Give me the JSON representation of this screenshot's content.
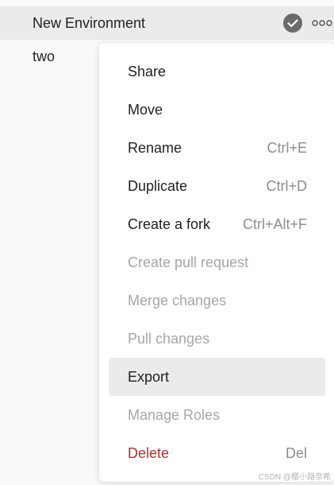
{
  "environments": [
    {
      "name": "New Environment",
      "active": true,
      "status_icon": "check-circle-icon",
      "more_icon": "more-horizontal-icon"
    },
    {
      "name": "two",
      "active": false
    }
  ],
  "context_menu": {
    "items": [
      {
        "label": "Share",
        "shortcut": "",
        "enabled": true
      },
      {
        "label": "Move",
        "shortcut": "",
        "enabled": true
      },
      {
        "label": "Rename",
        "shortcut": "Ctrl+E",
        "enabled": true
      },
      {
        "label": "Duplicate",
        "shortcut": "Ctrl+D",
        "enabled": true
      },
      {
        "label": "Create a fork",
        "shortcut": "Ctrl+Alt+F",
        "enabled": true
      },
      {
        "label": "Create pull request",
        "shortcut": "",
        "enabled": false
      },
      {
        "label": "Merge changes",
        "shortcut": "",
        "enabled": false
      },
      {
        "label": "Pull changes",
        "shortcut": "",
        "enabled": false
      },
      {
        "label": "Export",
        "shortcut": "",
        "enabled": true,
        "hovered": true
      },
      {
        "label": "Manage Roles",
        "shortcut": "",
        "enabled": false
      },
      {
        "label": "Delete",
        "shortcut": "Del",
        "enabled": true,
        "danger": true
      }
    ]
  },
  "watermark": "CSDN @樱小路奈希",
  "colors": {
    "active_row_bg": "#ebebeb",
    "page_bg": "#f9f9f9",
    "menu_bg": "#ffffff",
    "text": "#212121",
    "disabled_text": "#a6a6a6",
    "shortcut_text": "#8c8c8c",
    "danger_text": "#a83232",
    "check_icon_bg": "#6b6b6b"
  }
}
